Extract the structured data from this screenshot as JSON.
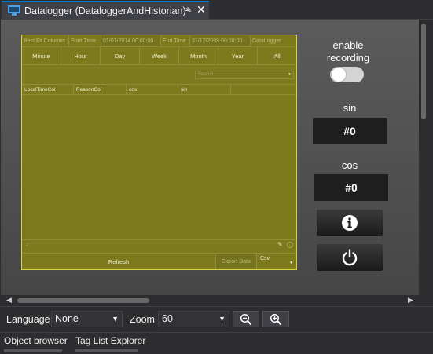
{
  "document_tab": {
    "title": "Datalogger (DataloggerAndHistorian)*",
    "icon": "monitor-icon",
    "pin_glyph": "⊸",
    "close_glyph": "✕"
  },
  "datalogger": {
    "toolbar": {
      "best_fit_label": "Best Fit Columns",
      "start_time_label": "Start Time",
      "start_time_value": "01/01/2014 00:00:00",
      "end_time_label": "End Time",
      "end_time_value": "31/12/2099 00:00:00",
      "table_name": "DataLogger"
    },
    "ranges": [
      "Minute",
      "Hour",
      "Day",
      "Week",
      "Month",
      "Year",
      "All"
    ],
    "search_placeholder": "Search",
    "columns": [
      "LocalTimeCol",
      "ReasonCol",
      "cos",
      "sin",
      ""
    ],
    "refresh_label": "Refresh",
    "export_label": "Export Data",
    "export_format": "Csv"
  },
  "panel": {
    "enable_label_line1": "enable",
    "enable_label_line2": "recording",
    "recording_enabled": false,
    "sin_label": "sin",
    "sin_value": "#0",
    "cos_label": "cos",
    "cos_value": "#0",
    "info_icon": "info-icon",
    "power_icon": "power-icon"
  },
  "toolbar": {
    "language_label": "Language :",
    "language_value": "None",
    "zoom_label": "Zoom :",
    "zoom_value": "60",
    "zoom_out_icon": "zoom-out-icon",
    "zoom_in_icon": "zoom-in-icon"
  },
  "bottom_tabs": [
    "Object browser",
    "Tag List Explorer"
  ],
  "colors": {
    "accent": "#007acc",
    "datalogger_bg": "#7c7a1c",
    "datalogger_border": "#d9d640"
  }
}
